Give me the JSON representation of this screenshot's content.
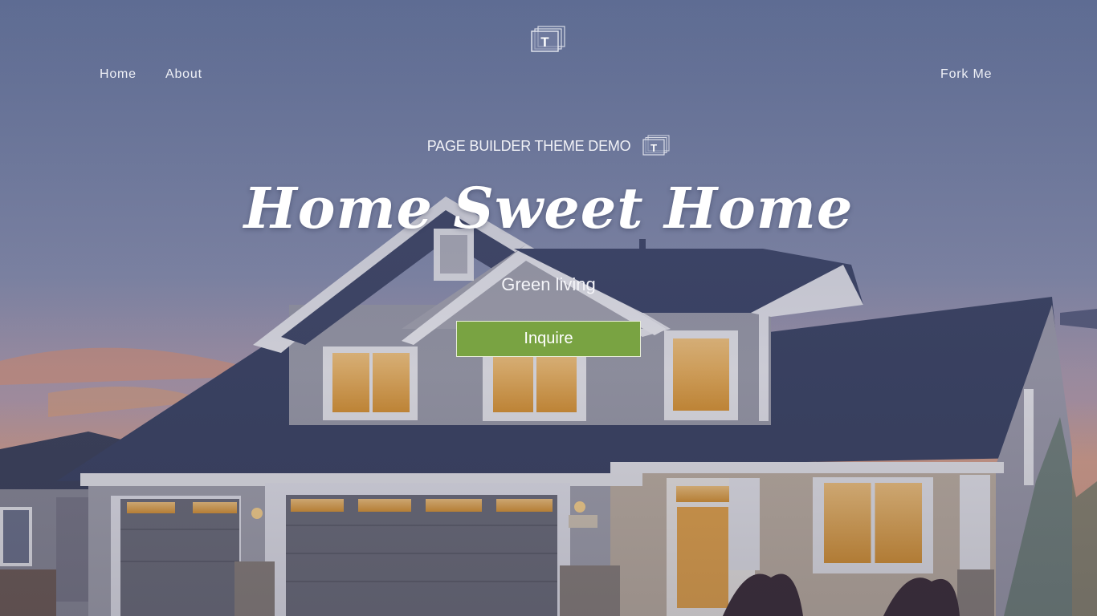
{
  "header": {
    "logo_icon": "t-stack-logo-icon",
    "nav": {
      "home_label": "Home",
      "about_label": "About",
      "fork_label": "Fork Me"
    }
  },
  "hero": {
    "kicker": "PAGE BUILDER THEME DEMO",
    "kicker_icon": "t-stack-logo-icon",
    "title": "Home Sweet Home",
    "subtitle": "Green living",
    "cta_label": "Inquire",
    "background_image": "suburban-house-at-dusk"
  },
  "colors": {
    "accent": "#79a342",
    "text": "#ffffff",
    "sky": "#6f7ea3"
  }
}
